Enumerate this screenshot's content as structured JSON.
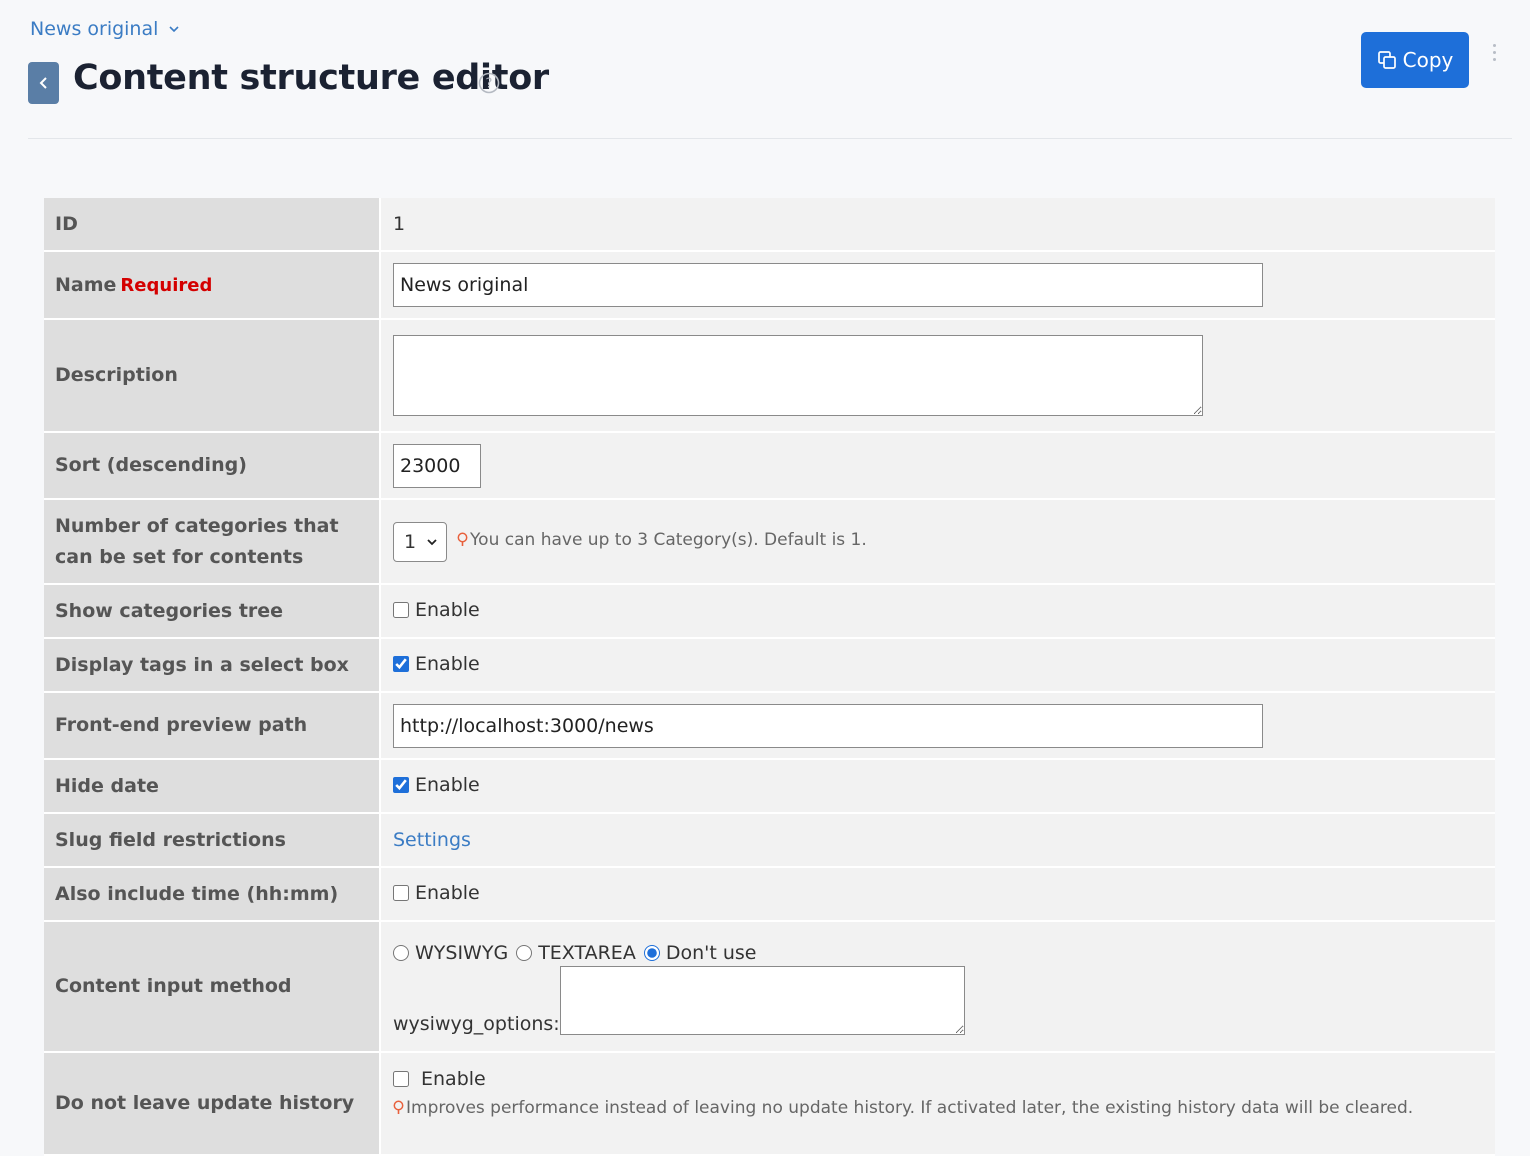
{
  "header": {
    "breadcrumb": "News original",
    "title": "Content structure editor",
    "copy_label": "Copy"
  },
  "rows": {
    "id": {
      "label": "ID",
      "value": "1"
    },
    "name": {
      "label": "Name",
      "required": "Required",
      "value": "News original"
    },
    "description": {
      "label": "Description",
      "value": ""
    },
    "sort": {
      "label": "Sort (descending)",
      "value": "23000"
    },
    "categories": {
      "label": "Number of categories that can be set for contents",
      "selected": "1",
      "hint": "You can have up to 3 Category(s). Default is 1."
    },
    "show_tree": {
      "label": "Show categories tree",
      "option": "Enable",
      "checked": false
    },
    "tags_select": {
      "label": "Display tags in a select box",
      "option": "Enable",
      "checked": true
    },
    "preview_path": {
      "label": "Front-end preview path",
      "value": "http://localhost:3000/news"
    },
    "hide_date": {
      "label": "Hide date",
      "option": "Enable",
      "checked": true
    },
    "slug": {
      "label": "Slug field restrictions",
      "link": "Settings"
    },
    "include_time": {
      "label": "Also include time (hh:mm)",
      "option": "Enable",
      "checked": false
    },
    "input_method": {
      "label": "Content input method",
      "options": [
        "WYSIWYG",
        "TEXTAREA",
        "Don't use"
      ],
      "selected": "Don't use",
      "wysiwyg_label": "wysiwyg_options:"
    },
    "no_history": {
      "label": "Do not leave update history",
      "option": "Enable",
      "checked": false,
      "hint": "Improves performance instead of leaving no update history. If activated later, the existing history data will be cleared."
    }
  },
  "colors": {
    "accent": "#1e6fd9",
    "link": "#3b7cc4",
    "required": "#d40000",
    "hint_icon": "#e8603c"
  }
}
